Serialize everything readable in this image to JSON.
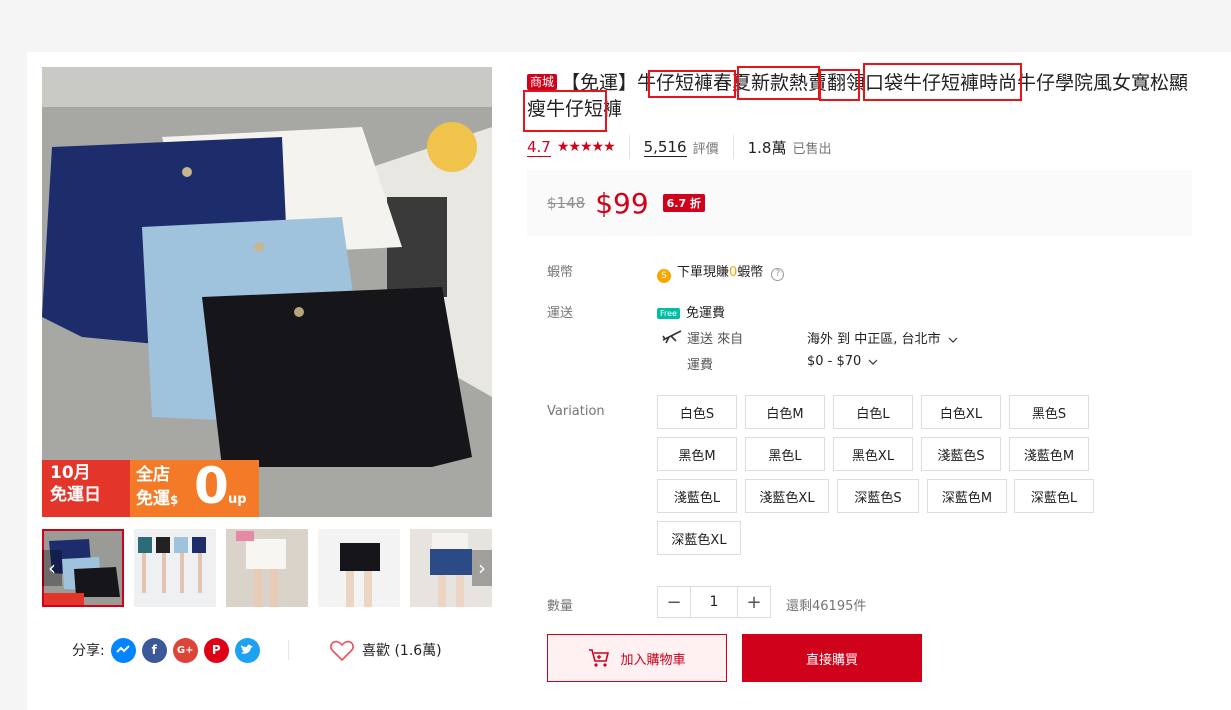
{
  "product": {
    "mall_badge": "商城",
    "title": "【免運】牛仔短褲春夏新款熱賣翻領口袋牛仔短褲時尚牛仔學院風女寬松顯瘦牛仔短褲",
    "rating": "4.7",
    "reviews_count": "5,516",
    "reviews_label": "評價",
    "sold_count": "1.8萬",
    "sold_label": "已售出",
    "old_price": "$148",
    "price": "$99",
    "discount": "6.7 折",
    "stars_value": 4.7
  },
  "banner": {
    "line1": "10月",
    "line2": "免運日",
    "line3": "全店",
    "line4": "免運",
    "line5": "$",
    "line6": "0",
    "line7": "up"
  },
  "details": {
    "coins_label": "蝦幣",
    "coins_text_pre": "下單現賺",
    "coins_amount": "0",
    "coins_text_post": "蝦幣",
    "shipping_label": "運送",
    "free_badge": "Free",
    "free_shipping": "免運費",
    "ship_from_label": "運送 來自",
    "ship_from_value": "海外 到 中正區, 台北市",
    "fee_label": "運費",
    "fee_value": "$0 - $70",
    "variation_label": "Variation",
    "variations": [
      "白色S",
      "白色M",
      "白色L",
      "白色XL",
      "黑色S",
      "黑色M",
      "黑色L",
      "黑色XL",
      "淺藍色S",
      "淺藍色M",
      "淺藍色L",
      "淺藍色XL",
      "深藍色S",
      "深藍色M",
      "深藍色L",
      "深藍色XL"
    ],
    "quantity_label": "數量",
    "quantity_value": "1",
    "stock_text": "還剩46195件"
  },
  "actions": {
    "add_to_cart": "加入購物車",
    "buy_now": "直接購買"
  },
  "share": {
    "label": "分享:",
    "like_text": "喜歡 (1.6萬)"
  },
  "colors": {
    "brand_red": "#d0011b",
    "annotation_red": "#e8141c",
    "coin_gold": "#f6a700",
    "free_teal": "#00bfa5"
  }
}
